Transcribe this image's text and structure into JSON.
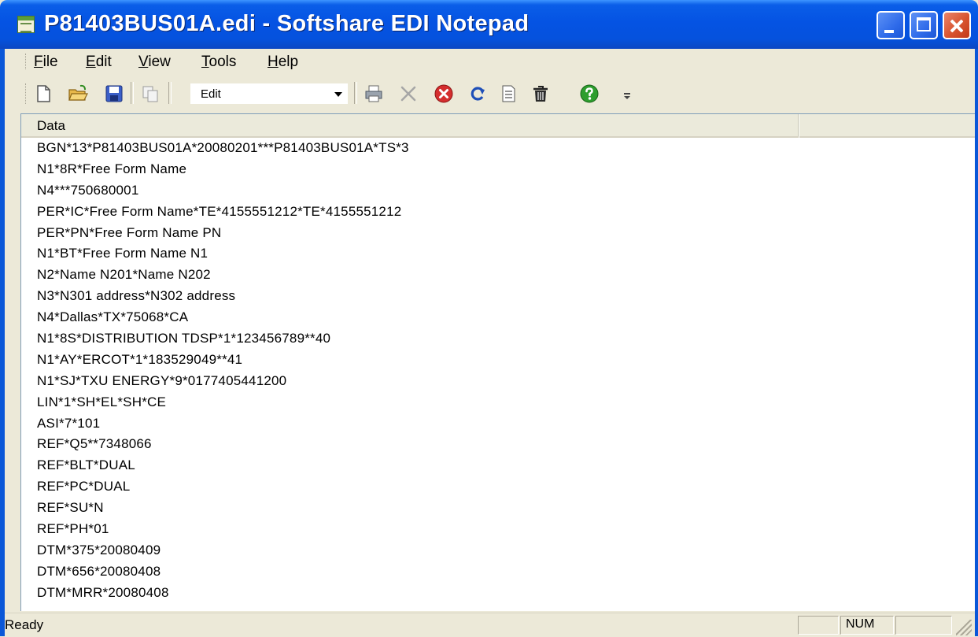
{
  "window": {
    "title": "P81403BUS01A.edi - Softshare EDI Notepad"
  },
  "menu": [
    {
      "label": "File",
      "accel": "F",
      "rest": "ile"
    },
    {
      "label": "Edit",
      "accel": "E",
      "rest": "dit"
    },
    {
      "label": "View",
      "accel": "V",
      "rest": "iew"
    },
    {
      "label": "Tools",
      "accel": "T",
      "rest": "ools"
    },
    {
      "label": "Help",
      "accel": "H",
      "rest": "elp"
    }
  ],
  "toolbar": {
    "mode_value": "Edit",
    "buttons": [
      {
        "name": "new-document-icon"
      },
      {
        "name": "open-folder-icon"
      },
      {
        "name": "save-icon"
      },
      {
        "name": "copy-icon"
      },
      {
        "name": "print-icon"
      },
      {
        "name": "cut-x-icon"
      },
      {
        "name": "stop-icon"
      },
      {
        "name": "refresh-icon"
      },
      {
        "name": "properties-icon"
      },
      {
        "name": "delete-icon"
      },
      {
        "name": "help-icon"
      }
    ]
  },
  "grid": {
    "header": "Data",
    "rows": [
      "BGN*13*P81403BUS01A*20080201***P81403BUS01A*TS*3",
      "N1*8R*Free Form Name",
      "N4***750680001",
      "PER*IC*Free Form Name*TE*4155551212*TE*4155551212",
      "PER*PN*Free Form Name PN",
      "N1*BT*Free Form Name N1",
      "N2*Name N201*Name N202",
      "N3*N301 address*N302 address",
      "N4*Dallas*TX*75068*CA",
      "N1*8S*DISTRIBUTION TDSP*1*123456789**40",
      "N1*AY*ERCOT*1*183529049**41",
      "N1*SJ*TXU ENERGY*9*0177405441200",
      "LIN*1*SH*EL*SH*CE",
      "ASI*7*101",
      "REF*Q5**7348066",
      "REF*BLT*DUAL",
      "REF*PC*DUAL",
      "REF*SU*N",
      "REF*PH*01",
      "DTM*375*20080409",
      "DTM*656*20080408",
      "DTM*MRR*20080408"
    ]
  },
  "status": {
    "text": "Ready",
    "num": "NUM"
  },
  "colors": {
    "titlebar": "#0553E3",
    "close_button": "#D8542F",
    "chrome": "#ECE9D8"
  }
}
